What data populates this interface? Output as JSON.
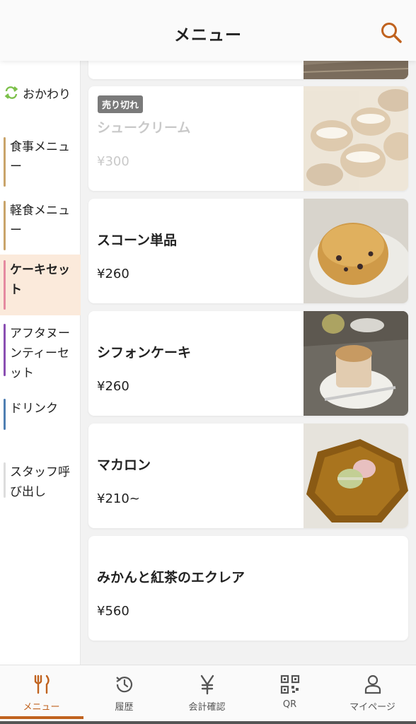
{
  "header": {
    "title": "メニュー"
  },
  "sidebar": {
    "refill": "おかわり",
    "categories": [
      {
        "label": "食事メニュー",
        "color": "#c9a46b"
      },
      {
        "label": "軽食メニュー",
        "color": "#c9a46b"
      },
      {
        "label": "ケーキセット",
        "color": "#e58aa0",
        "active": true
      },
      {
        "label": "アフタヌーンティーセット",
        "color": "#8a4fb2"
      },
      {
        "label": "ドリンク",
        "color": "#4f7fb2"
      },
      {
        "label": "スタッフ呼び出し",
        "color": "#dddddd"
      }
    ]
  },
  "items": [
    {
      "name": "",
      "price": "",
      "partial": true
    },
    {
      "name": "シュークリーム",
      "price": "¥300",
      "badge": "売り切れ",
      "sold_out": true
    },
    {
      "name": "スコーン単品",
      "price": "¥260"
    },
    {
      "name": "シフォンケーキ",
      "price": "¥260"
    },
    {
      "name": "マカロン",
      "price": "¥210~"
    },
    {
      "name": "みかんと紅茶のエクレア",
      "price": "¥560"
    }
  ],
  "nav": [
    {
      "label": "メニュー",
      "icon": "fork-knife-icon",
      "active": true
    },
    {
      "label": "履歴",
      "icon": "history-icon"
    },
    {
      "label": "会計確認",
      "icon": "yen-icon"
    },
    {
      "label": "QR",
      "icon": "qr-code-icon"
    },
    {
      "label": "マイページ",
      "icon": "user-icon"
    }
  ],
  "colors": {
    "accent": "#c0621e",
    "refill_icon": "#7cc04a"
  }
}
